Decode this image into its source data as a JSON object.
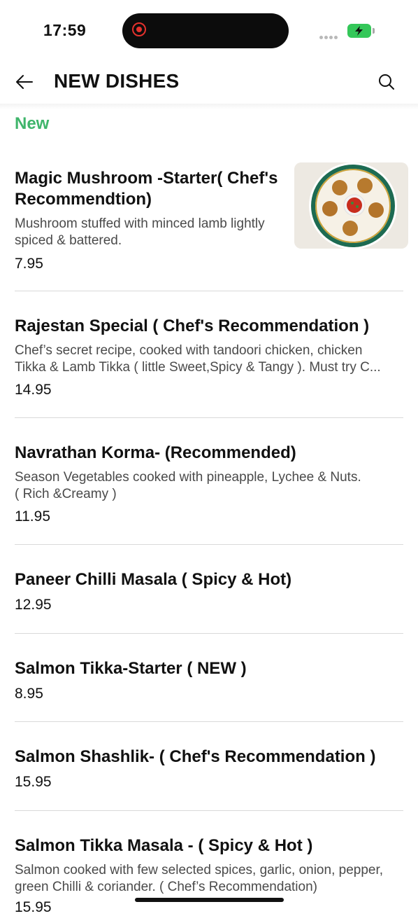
{
  "status_bar": {
    "time": "17:59",
    "colors": {
      "record": "#e5322d",
      "battery": "#34c759"
    },
    "icons": [
      "record-icon",
      "signal-icon",
      "battery-charging-icon"
    ]
  },
  "header": {
    "title": "NEW DISHES",
    "back_icon": "arrow-left-icon",
    "search_icon": "search-icon"
  },
  "section": {
    "label": "New",
    "color": "#3fb56b"
  },
  "dishes": [
    {
      "name_line1": "Magic Mushroom -Starter( Chef's",
      "name_line2": "Recommendtion)",
      "desc_line1": "Mushroom stuffed with minced lamb lightly",
      "desc_line2": "spiced & battered.",
      "price": "7.95"
    },
    {
      "name_line1": "Rajestan Special ( Chef's Recommendation )",
      "desc_line1": "Chef’s secret recipe, cooked with tandoori chicken, chicken",
      "desc_line2": "Tikka & Lamb Tikka ( little Sweet,Spicy & Tangy ). Must try C...",
      "price": "14.95"
    },
    {
      "name_line1": "Navrathan Korma- (Recommended)",
      "desc_line1": "Season Vegetables cooked with pineapple, Lychee & Nuts.",
      "desc_line2": "( Rich &Creamy )",
      "price": "11.95"
    },
    {
      "name_line1": "Paneer Chilli Masala ( Spicy & Hot)",
      "price": "12.95"
    },
    {
      "name_line1": "Salmon Tikka-Starter ( NEW )",
      "price": "8.95"
    },
    {
      "name_line1": "Salmon Shashlik- ( Chef's Recommendation )",
      "price": "15.95"
    },
    {
      "name_line1": "Salmon Tikka Masala - ( Spicy & Hot )",
      "desc_line1": "Salmon cooked with few selected spices, garlic, onion, pepper,",
      "desc_line2": "green Chilli & coriander. ( Chef’s Recommendation)",
      "price": "15.95"
    }
  ]
}
